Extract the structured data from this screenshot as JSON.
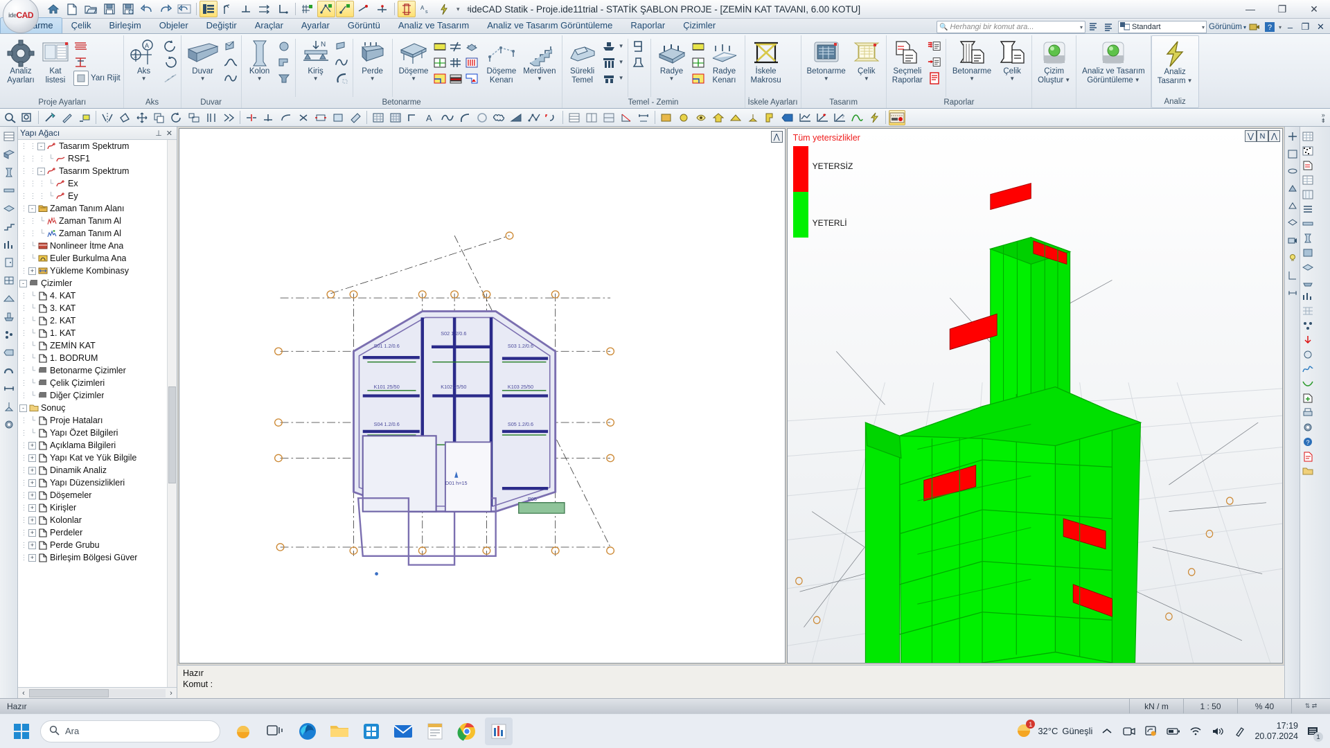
{
  "window": {
    "title": "ideCAD Statik - Proje.ide11trial - STATİK ŞABLON PROJE - [ZEMİN KAT TAVANI,  6.00 KOTU]",
    "minimize": "—",
    "restore": "❐",
    "close": "✕",
    "logo_ide": "ide",
    "logo_cad": "CAD"
  },
  "quick_access": {
    "items": [
      {
        "name": "home-icon",
        "glyph": "⌂"
      },
      {
        "name": "new-file-icon",
        "glyph": "🗋"
      },
      {
        "name": "open-folder-icon",
        "glyph": "📂"
      },
      {
        "name": "save-icon",
        "glyph": "💾"
      },
      {
        "name": "save-as-icon",
        "glyph": "🖫"
      },
      {
        "name": "undo-icon",
        "glyph": "↶"
      },
      {
        "name": "redo-icon",
        "glyph": "↷"
      },
      {
        "name": "revert-icon",
        "glyph": "↺"
      }
    ],
    "overflow_caret": "▾"
  },
  "ribbon": {
    "tabs": [
      {
        "label": "Betonarme",
        "active": true
      },
      {
        "label": "Çelik",
        "active": false
      },
      {
        "label": "Birleşim",
        "active": false
      },
      {
        "label": "Objeler",
        "active": false
      },
      {
        "label": "Değiştir",
        "active": false
      },
      {
        "label": "Araçlar",
        "active": false
      },
      {
        "label": "Ayarlar",
        "active": false
      },
      {
        "label": "Görüntü",
        "active": false
      },
      {
        "label": "Analiz ve Tasarım",
        "active": false
      },
      {
        "label": "Analiz ve Tasarım Görüntüleme",
        "active": false
      },
      {
        "label": "Raporlar",
        "active": false
      },
      {
        "label": "Çizimler",
        "active": false
      }
    ],
    "search_placeholder": "Herhangi bir komut ara...",
    "style_combo_value": "Standart",
    "view_combo_label": "Görünüm",
    "groups": [
      {
        "name": "proje-ayarlari",
        "label": "Proje Ayarları",
        "big": [
          {
            "label": "Analiz",
            "label2": "Ayarları",
            "icon": "gear-icon"
          },
          {
            "label": "Kat",
            "label2": "listesi",
            "icon": "floor-list-icon"
          }
        ],
        "small": [
          {
            "label": "",
            "icon": "layers-icon"
          },
          {
            "label": "",
            "icon": "rigid-diaphragm-icon"
          },
          {
            "label": "Yarı Rijit",
            "icon": "semi-rigid-icon"
          }
        ]
      },
      {
        "name": "aks",
        "label": "Aks",
        "big": [
          {
            "label": "Aks",
            "label2": "",
            "icon": "axis-icon"
          }
        ],
        "small": [
          {
            "label": "",
            "icon": "axis-rotate-cw-icon"
          },
          {
            "label": "",
            "icon": "axis-rotate-ccw-icon"
          },
          {
            "label": "",
            "icon": "axis-line-icon"
          }
        ]
      },
      {
        "name": "duvar",
        "label": "Duvar",
        "big": [
          {
            "label": "Duvar",
            "label2": "",
            "icon": "wall-icon"
          }
        ],
        "small": [
          {
            "label": "",
            "icon": "wall-corner-icon"
          },
          {
            "label": "",
            "icon": "wall-curve-icon"
          },
          {
            "label": "",
            "icon": "wall-spline-icon"
          }
        ]
      },
      {
        "name": "betonarme",
        "label": "Betonarme",
        "big": [
          {
            "label": "Kolon",
            "label2": "",
            "icon": "column-icon"
          },
          {
            "label": "Kiriş",
            "label2": "",
            "icon": "beam-icon"
          },
          {
            "label": "Perde",
            "label2": "",
            "icon": "shearwall-icon"
          },
          {
            "label": "Döşeme",
            "label2": "",
            "icon": "slab-icon"
          },
          {
            "label": "Döşeme",
            "label2": "Kenarı",
            "icon": "slab-edge-icon"
          },
          {
            "label": "Merdiven",
            "label2": "",
            "icon": "stairs-icon"
          }
        ],
        "small": []
      },
      {
        "name": "temel-zemin",
        "label": "Temel - Zemin",
        "big": [
          {
            "label": "Sürekli",
            "label2": "Temel",
            "icon": "strip-footing-icon"
          },
          {
            "label": "Radye",
            "label2": "",
            "icon": "raft-icon"
          },
          {
            "label": "Radye",
            "label2": "Kenarı",
            "icon": "raft-edge-icon"
          }
        ],
        "small": []
      },
      {
        "name": "iskele-ayarlari",
        "label": "İskele Ayarları",
        "big": [
          {
            "label": "İskele",
            "label2": "Makrosu",
            "icon": "scaffold-icon"
          }
        ],
        "small": []
      },
      {
        "name": "tasarim",
        "label": "Tasarım",
        "big": [
          {
            "label": "Betonarme",
            "label2": "",
            "icon": "rc-design-icon"
          },
          {
            "label": "Çelik",
            "label2": "",
            "icon": "steel-design-icon"
          }
        ],
        "small": []
      },
      {
        "name": "raporlar",
        "label": "Raporlar",
        "big": [
          {
            "label": "Seçmeli",
            "label2": "Raporlar",
            "icon": "selective-reports-icon"
          },
          {
            "label": "Betonarme",
            "label2": "",
            "icon": "rc-report-icon"
          },
          {
            "label": "Çelik",
            "label2": "",
            "icon": "steel-report-icon"
          }
        ],
        "small": []
      },
      {
        "name": "cizim-olustur",
        "label": "",
        "big": [
          {
            "label": "Çizim",
            "label2": "Oluştur",
            "icon": "green-orb-icon"
          }
        ],
        "small": []
      },
      {
        "name": "analiz-tasarim-goruntuleme",
        "label": "",
        "big": [
          {
            "label": "Analiz ve Tasarım",
            "label2": "Görüntüleme",
            "icon": "green-orb-icon"
          }
        ],
        "small": []
      },
      {
        "name": "analiz",
        "label": "Analiz",
        "big": [
          {
            "label": "Analiz",
            "label2": "Tasarım",
            "icon": "lightning-icon"
          }
        ],
        "small": []
      }
    ]
  },
  "tree_panel": {
    "title": "Yapı Ağacı",
    "pin_icon": "pin-icon",
    "close_icon": "close-icon",
    "nodes": [
      {
        "label": "Tasarım Spektrum",
        "indent": 3,
        "expander": "-",
        "icon": "spectrum-plus-icon"
      },
      {
        "label": "RSF1",
        "indent": 4,
        "expander": "",
        "icon": "spectrum-icon"
      },
      {
        "label": "Tasarım Spektrum",
        "indent": 3,
        "expander": "-",
        "icon": "spectrum-plus-icon"
      },
      {
        "label": "Ex",
        "indent": 4,
        "expander": "",
        "icon": "spectrum-plus-icon"
      },
      {
        "label": "Ey",
        "indent": 4,
        "expander": "",
        "icon": "spectrum-plus-icon"
      },
      {
        "label": "Zaman Tanım Alanı",
        "indent": 2,
        "expander": "-",
        "icon": "folder-time-icon"
      },
      {
        "label": "Zaman Tanım Al",
        "indent": 3,
        "expander": "",
        "icon": "time-history-icon"
      },
      {
        "label": "Zaman Tanım Al",
        "indent": 3,
        "expander": "",
        "icon": "time-history2-icon"
      },
      {
        "label": "Nonlineer İtme Ana",
        "indent": 2,
        "expander": "",
        "icon": "pushover-icon"
      },
      {
        "label": "Euler Burkulma Ana",
        "indent": 2,
        "expander": "",
        "icon": "buckling-icon"
      },
      {
        "label": "Yükleme Kombinasy",
        "indent": 2,
        "expander": "+",
        "icon": "load-combo-icon"
      },
      {
        "label": "Çizimler",
        "indent": 1,
        "expander": "-",
        "icon": "drawings-icon"
      },
      {
        "label": "4. KAT",
        "indent": 2,
        "expander": "",
        "icon": "page-icon"
      },
      {
        "label": "3. KAT",
        "indent": 2,
        "expander": "",
        "icon": "page-icon"
      },
      {
        "label": "2. KAT",
        "indent": 2,
        "expander": "",
        "icon": "page-icon"
      },
      {
        "label": "1. KAT",
        "indent": 2,
        "expander": "",
        "icon": "page-icon"
      },
      {
        "label": "ZEMİN KAT",
        "indent": 2,
        "expander": "",
        "icon": "page-icon"
      },
      {
        "label": "1. BODRUM",
        "indent": 2,
        "expander": "",
        "icon": "page-icon"
      },
      {
        "label": "Betonarme Çizimler",
        "indent": 2,
        "expander": "",
        "icon": "drawings-icon"
      },
      {
        "label": "Çelik Çizimleri",
        "indent": 2,
        "expander": "",
        "icon": "drawings-icon"
      },
      {
        "label": "Diğer Çizimler",
        "indent": 2,
        "expander": "",
        "icon": "drawings-icon"
      },
      {
        "label": "Sonuç",
        "indent": 1,
        "expander": "-",
        "icon": "folder-icon"
      },
      {
        "label": "Proje Hataları",
        "indent": 2,
        "expander": "",
        "icon": "page-icon"
      },
      {
        "label": "Yapı Özet Bilgileri",
        "indent": 2,
        "expander": "",
        "icon": "page-icon"
      },
      {
        "label": "Açıklama Bilgileri",
        "indent": 2,
        "expander": "+",
        "icon": "page-icon"
      },
      {
        "label": "Yapı Kat ve Yük Bilgile",
        "indent": 2,
        "expander": "+",
        "icon": "page-icon"
      },
      {
        "label": "Dinamik Analiz",
        "indent": 2,
        "expander": "+",
        "icon": "page-icon"
      },
      {
        "label": "Yapı Düzensizlikleri",
        "indent": 2,
        "expander": "+",
        "icon": "page-icon"
      },
      {
        "label": "Döşemeler",
        "indent": 2,
        "expander": "+",
        "icon": "page-icon"
      },
      {
        "label": "Kirişler",
        "indent": 2,
        "expander": "+",
        "icon": "page-icon"
      },
      {
        "label": "Kolonlar",
        "indent": 2,
        "expander": "+",
        "icon": "page-icon"
      },
      {
        "label": "Perdeler",
        "indent": 2,
        "expander": "+",
        "icon": "page-icon"
      },
      {
        "label": "Perde Grubu",
        "indent": 2,
        "expander": "+",
        "icon": "page-icon"
      },
      {
        "label": "Birleşim Bölgesi Güver",
        "indent": 2,
        "expander": "+",
        "icon": "page-icon"
      }
    ],
    "scroll_left": "‹",
    "scroll_right": "›"
  },
  "views": {
    "plan_badge": "⋀",
    "view3d_badges": [
      "⋁",
      "N",
      "⋀"
    ],
    "legend": {
      "title": "Tüm yetersizlikler",
      "entries": [
        {
          "label": "YETERSİZ",
          "color": "#ff0000"
        },
        {
          "label": "YETERLİ",
          "color": "#00f000"
        }
      ]
    }
  },
  "command_pane": {
    "status": "Hazır",
    "prompt": "Komut :"
  },
  "status_bar": {
    "ready": "Hazır",
    "unit": "kN / m",
    "scale": "1 : 50",
    "zoom": "% 40"
  },
  "taskbar": {
    "search_placeholder": "Ara",
    "search_icon": "search-icon",
    "start_icon": "windows-start-icon",
    "apps": [
      {
        "name": "taskview-icon",
        "glyph": "❑"
      },
      {
        "name": "edge-icon",
        "glyph": "e"
      },
      {
        "name": "file-explorer-icon",
        "glyph": "🗂"
      },
      {
        "name": "store-icon",
        "glyph": "🛍"
      },
      {
        "name": "mail-icon",
        "glyph": "✉"
      },
      {
        "name": "notepad-icon",
        "glyph": "📝"
      },
      {
        "name": "chrome-icon",
        "glyph": "◉"
      },
      {
        "name": "idecad-taskbar-icon",
        "glyph": "▤"
      }
    ],
    "weather_temp": "32°C",
    "weather_desc": "Güneşli",
    "weather_badge": "1",
    "tray": [
      {
        "name": "show-hidden-icons-icon",
        "glyph": "⌃"
      },
      {
        "name": "camera-icon",
        "glyph": "⬚"
      },
      {
        "name": "screen-share-icon",
        "glyph": "⧉"
      },
      {
        "name": "battery-icon",
        "glyph": "▭"
      },
      {
        "name": "wifi-icon",
        "glyph": "⌁"
      },
      {
        "name": "volume-icon",
        "glyph": "🔊"
      },
      {
        "name": "pen-icon",
        "glyph": "✎"
      }
    ],
    "time": "17:19",
    "date": "20.07.2024",
    "notification_count": "1",
    "notification_icon": "notification-icon"
  }
}
